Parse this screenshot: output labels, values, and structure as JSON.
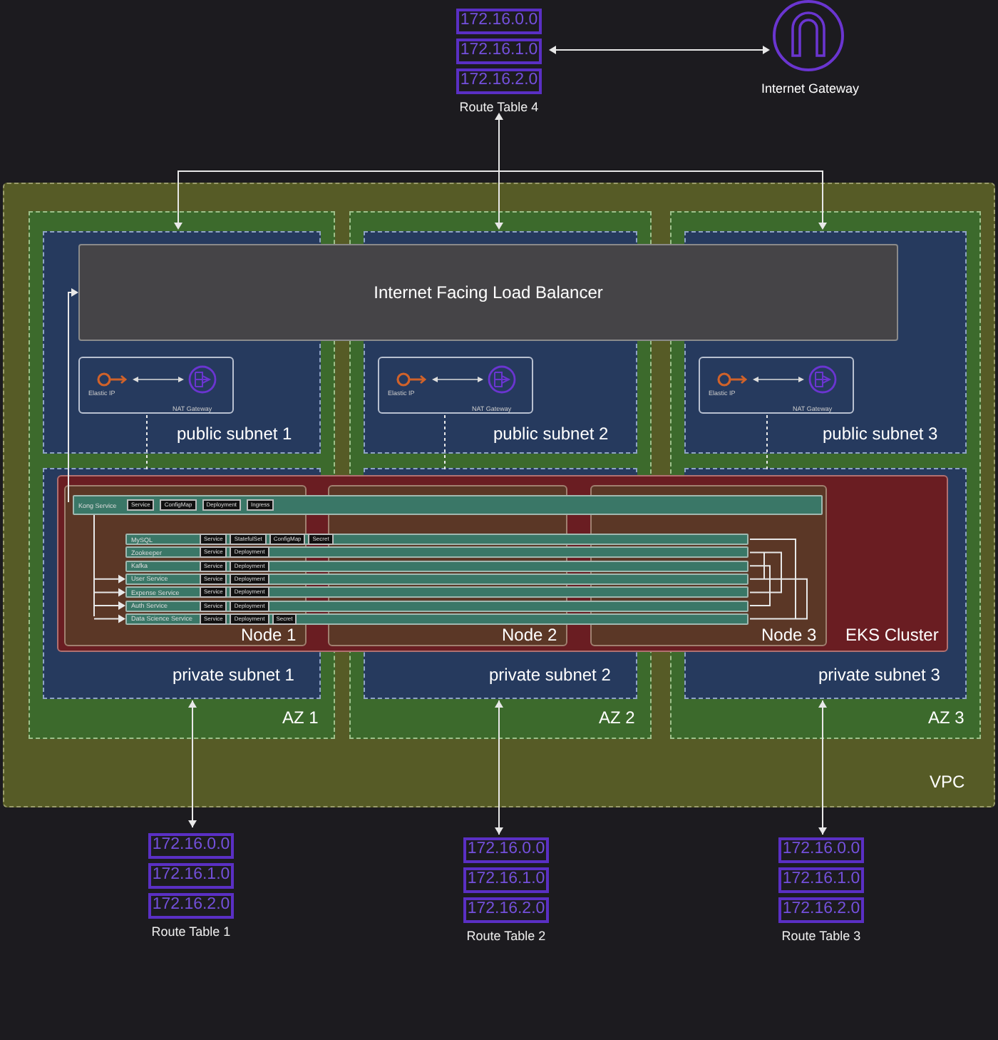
{
  "internet_gateway": {
    "label": "Internet Gateway"
  },
  "route_tables": [
    {
      "label": "Route Table 4",
      "entries": [
        "172.16.0.0",
        "172.16.1.0",
        "172.16.2.0"
      ]
    },
    {
      "label": "Route Table 1",
      "entries": [
        "172.16.0.0",
        "172.16.1.0",
        "172.16.2.0"
      ]
    },
    {
      "label": "Route Table 2",
      "entries": [
        "172.16.0.0",
        "172.16.1.0",
        "172.16.2.0"
      ]
    },
    {
      "label": "Route Table 3",
      "entries": [
        "172.16.0.0",
        "172.16.1.0",
        "172.16.2.0"
      ]
    }
  ],
  "vpc": {
    "label": "VPC"
  },
  "load_balancer": {
    "label": "Internet Facing Load Balancer"
  },
  "availability_zones": [
    {
      "label": "AZ 1",
      "public_subnet": {
        "label": "public subnet 1",
        "elastic_ip": "Elastic IP",
        "nat_gateway": "NAT Gateway"
      },
      "private_subnet": {
        "label": "private subnet 1"
      }
    },
    {
      "label": "AZ 2",
      "public_subnet": {
        "label": "public subnet 2",
        "elastic_ip": "Elastic IP",
        "nat_gateway": "NAT Gateway"
      },
      "private_subnet": {
        "label": "private subnet 2"
      }
    },
    {
      "label": "AZ 3",
      "public_subnet": {
        "label": "public subnet 3",
        "elastic_ip": "Elastic IP",
        "nat_gateway": "NAT Gateway"
      },
      "private_subnet": {
        "label": "private subnet 3"
      }
    }
  ],
  "eks_cluster": {
    "label": "EKS Cluster",
    "nodes": [
      "Node 1",
      "Node 2",
      "Node 3"
    ],
    "gateway": {
      "name": "Kong Service",
      "resources": [
        "Service",
        "ConfigMap",
        "Deployment",
        "Ingress"
      ]
    },
    "services": [
      {
        "name": "MySQL",
        "resources": [
          "Service",
          "StatefulSet",
          "ConfigMap",
          "Secret"
        ]
      },
      {
        "name": "Zookeeper",
        "resources": [
          "Service",
          "Deployment"
        ]
      },
      {
        "name": "Kafka",
        "resources": [
          "Service",
          "Deployment"
        ]
      },
      {
        "name": "User Service",
        "resources": [
          "Service",
          "Deployment"
        ]
      },
      {
        "name": "Expense Service",
        "resources": [
          "Service",
          "Deployment"
        ]
      },
      {
        "name": "Auth Service",
        "resources": [
          "Service",
          "Deployment"
        ]
      },
      {
        "name": "Data Science Service",
        "resources": [
          "Service",
          "Deployment",
          "Secret"
        ]
      }
    ]
  }
}
